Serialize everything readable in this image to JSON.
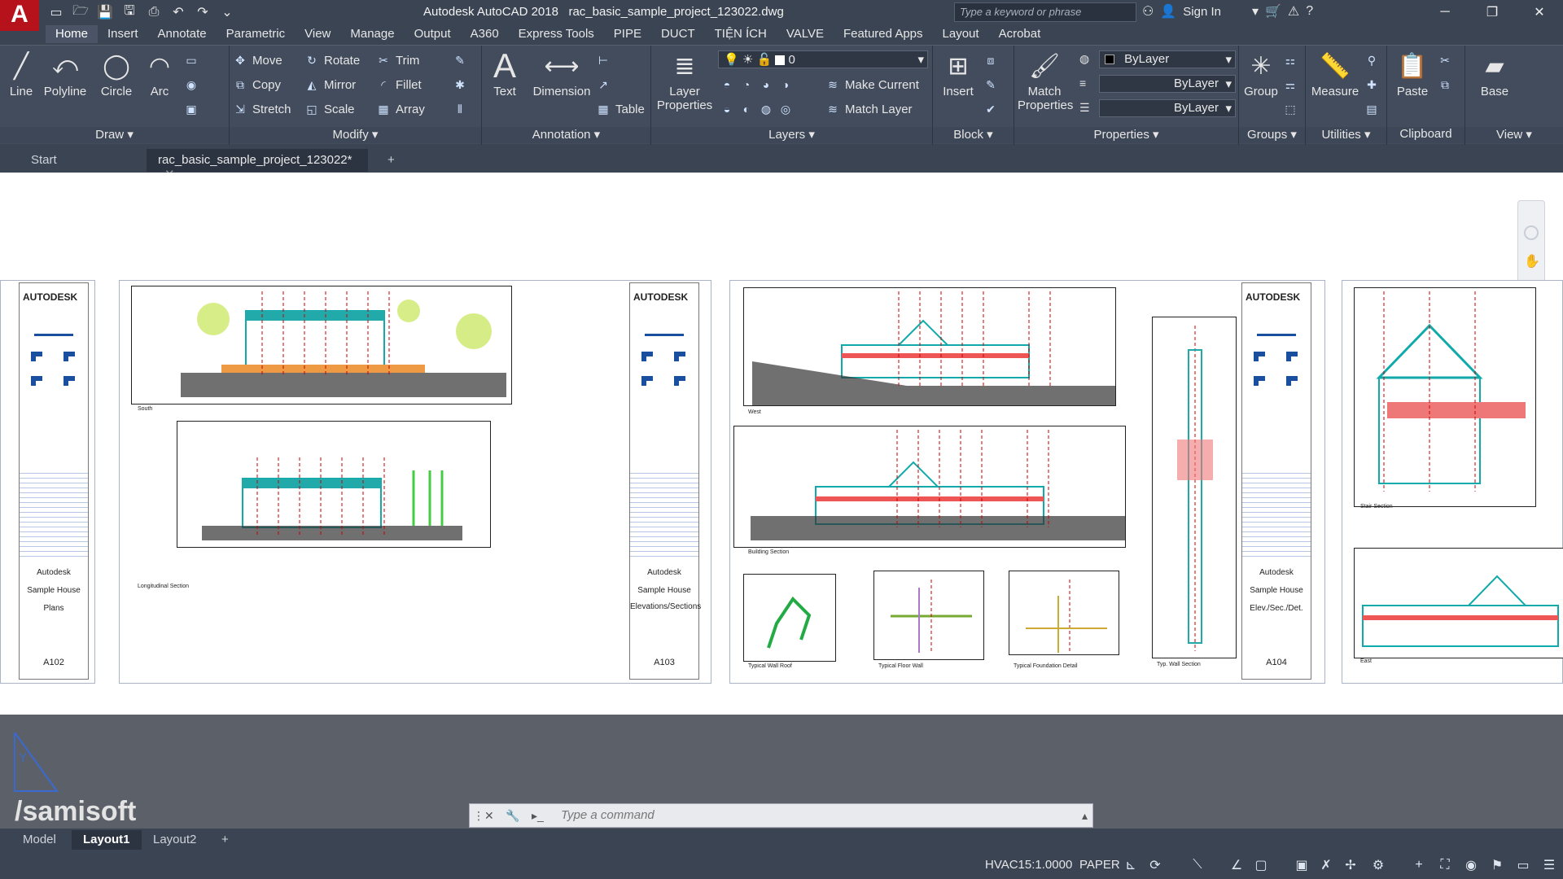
{
  "app": {
    "logo_letter": "A",
    "title": "Autodesk AutoCAD 2018",
    "file": "rac_basic_sample_project_123022.dwg",
    "search_placeholder": "Type a keyword or phrase",
    "sign_in": "Sign In"
  },
  "ribbon_tabs": [
    "Home",
    "Insert",
    "Annotate",
    "Parametric",
    "View",
    "Manage",
    "Output",
    "A360",
    "Express Tools",
    "PIPE",
    "DUCT",
    "TIỆN ÍCH",
    "VALVE",
    "Featured Apps",
    "Layout",
    "Acrobat"
  ],
  "ribbon": {
    "draw": {
      "title": "Draw",
      "line": "Line",
      "polyline": "Polyline",
      "circle": "Circle",
      "arc": "Arc"
    },
    "modify": {
      "title": "Modify",
      "move": "Move",
      "rotate": "Rotate",
      "trim": "Trim",
      "copy": "Copy",
      "mirror": "Mirror",
      "fillet": "Fillet",
      "stretch": "Stretch",
      "scale": "Scale",
      "array": "Array"
    },
    "annotation": {
      "title": "Annotation",
      "text": "Text",
      "dimension": "Dimension",
      "table": "Table"
    },
    "layers": {
      "title": "Layers",
      "layer_properties_1": "Layer",
      "layer_properties_2": "Properties",
      "current_layer": "0",
      "make_current": "Make Current",
      "match_layer": "Match Layer"
    },
    "block": {
      "title": "Block",
      "insert": "Insert"
    },
    "properties": {
      "title": "Properties",
      "match_1": "Match",
      "match_2": "Properties",
      "color": "ByLayer",
      "linetype": "ByLayer",
      "lineweight": "ByLayer"
    },
    "groups": {
      "title": "Groups",
      "group": "Group"
    },
    "utilities": {
      "title": "Utilities",
      "measure": "Measure"
    },
    "clipboard": {
      "title": "Clipboard",
      "paste": "Paste"
    },
    "view": {
      "title": "View",
      "base": "Base"
    }
  },
  "doc_tabs": {
    "start": "Start",
    "file": "rac_basic_sample_project_123022*"
  },
  "sheets": {
    "logo": "AUTODESK",
    "s1": {
      "company": "Autodesk",
      "project": "Sample House",
      "title": "Plans",
      "number": "A102"
    },
    "s2": {
      "company": "Autodesk",
      "project": "Sample House",
      "title": "Elevations/Sections",
      "number": "A103",
      "south": "South",
      "long_section": "Longitudinal Section"
    },
    "s3": {
      "company": "Autodesk",
      "project": "Sample House",
      "title": "Elev./Sec./Det.",
      "number": "A104",
      "west": "West",
      "building_section": "Building Section",
      "typ_wall_roof": "Typical Wall Roof",
      "typ_floor_wall": "Typical Floor Wall",
      "typ_foundation": "Typical Foundation Detail",
      "typ_wall_section": "Typ. Wall Section"
    },
    "s4": {
      "stair_section": "Stair Section",
      "east": "East"
    }
  },
  "cmd": {
    "placeholder": "Type a command"
  },
  "watermark": "/samisoft",
  "layout_tabs": [
    "Model",
    "Layout1",
    "Layout2"
  ],
  "status": {
    "scale": "HVAC15:1.0000",
    "space": "PAPER"
  },
  "colors": {
    "accent": "#b5121b",
    "ribbon": "#434c5c",
    "frame": "#3b4453"
  }
}
